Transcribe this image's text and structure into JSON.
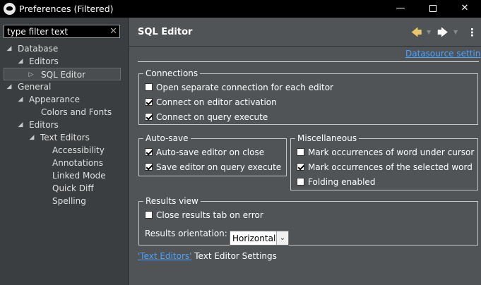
{
  "window": {
    "title": "Preferences (Filtered)",
    "minimize": "—",
    "close": "✕"
  },
  "filter": {
    "value": "type filter text",
    "clear": "✕"
  },
  "tree": [
    {
      "label": "Database",
      "twisty": "◢"
    },
    {
      "label": "Editors",
      "twisty": "◢"
    },
    {
      "label": "SQL Editor",
      "twisty": "▷"
    },
    {
      "label": "General",
      "twisty": "◢"
    },
    {
      "label": "Appearance",
      "twisty": "◢"
    },
    {
      "label": "Colors and Fonts",
      "twisty": ""
    },
    {
      "label": "Editors",
      "twisty": "◢"
    },
    {
      "label": "Text Editors",
      "twisty": "◢"
    },
    {
      "label": "Accessibility",
      "twisty": ""
    },
    {
      "label": "Annotations",
      "twisty": ""
    },
    {
      "label": "Linked Mode",
      "twisty": ""
    },
    {
      "label": "Quick Diff",
      "twisty": ""
    },
    {
      "label": "Spelling",
      "twisty": ""
    }
  ],
  "page": {
    "title": "SQL Editor",
    "back_icon": "🡄",
    "forward_icon": "🡆",
    "dropdown_arrow": "▼",
    "menu_icon": "⋮",
    "datasource_link": "Datasource settings"
  },
  "connections": {
    "title": "Connections",
    "items": [
      {
        "label": "Open separate connection for each editor",
        "checked": false
      },
      {
        "label": "Connect on editor activation",
        "checked": true
      },
      {
        "label": "Connect on query execute",
        "checked": true
      }
    ]
  },
  "autosave": {
    "title": "Auto-save",
    "items": [
      {
        "label": "Auto-save editor on close",
        "checked": true
      },
      {
        "label": "Save editor on query execute",
        "checked": true
      }
    ]
  },
  "misc": {
    "title": "Miscellaneous",
    "items": [
      {
        "label": "Mark occurrences of word under cursor",
        "checked": false
      },
      {
        "label": "Mark occurrences of the selected word",
        "checked": true
      },
      {
        "label": "Folding enabled",
        "checked": false
      }
    ]
  },
  "results": {
    "title": "Results view",
    "close_tab": {
      "label": "Close results tab on error",
      "checked": false
    },
    "orientation_label": "Results orientation:",
    "orientation_value": "Horizontal",
    "dropdown_icon": "⌄"
  },
  "footer": {
    "link": "'Text Editors'",
    "text": " Text Editor Settings"
  }
}
